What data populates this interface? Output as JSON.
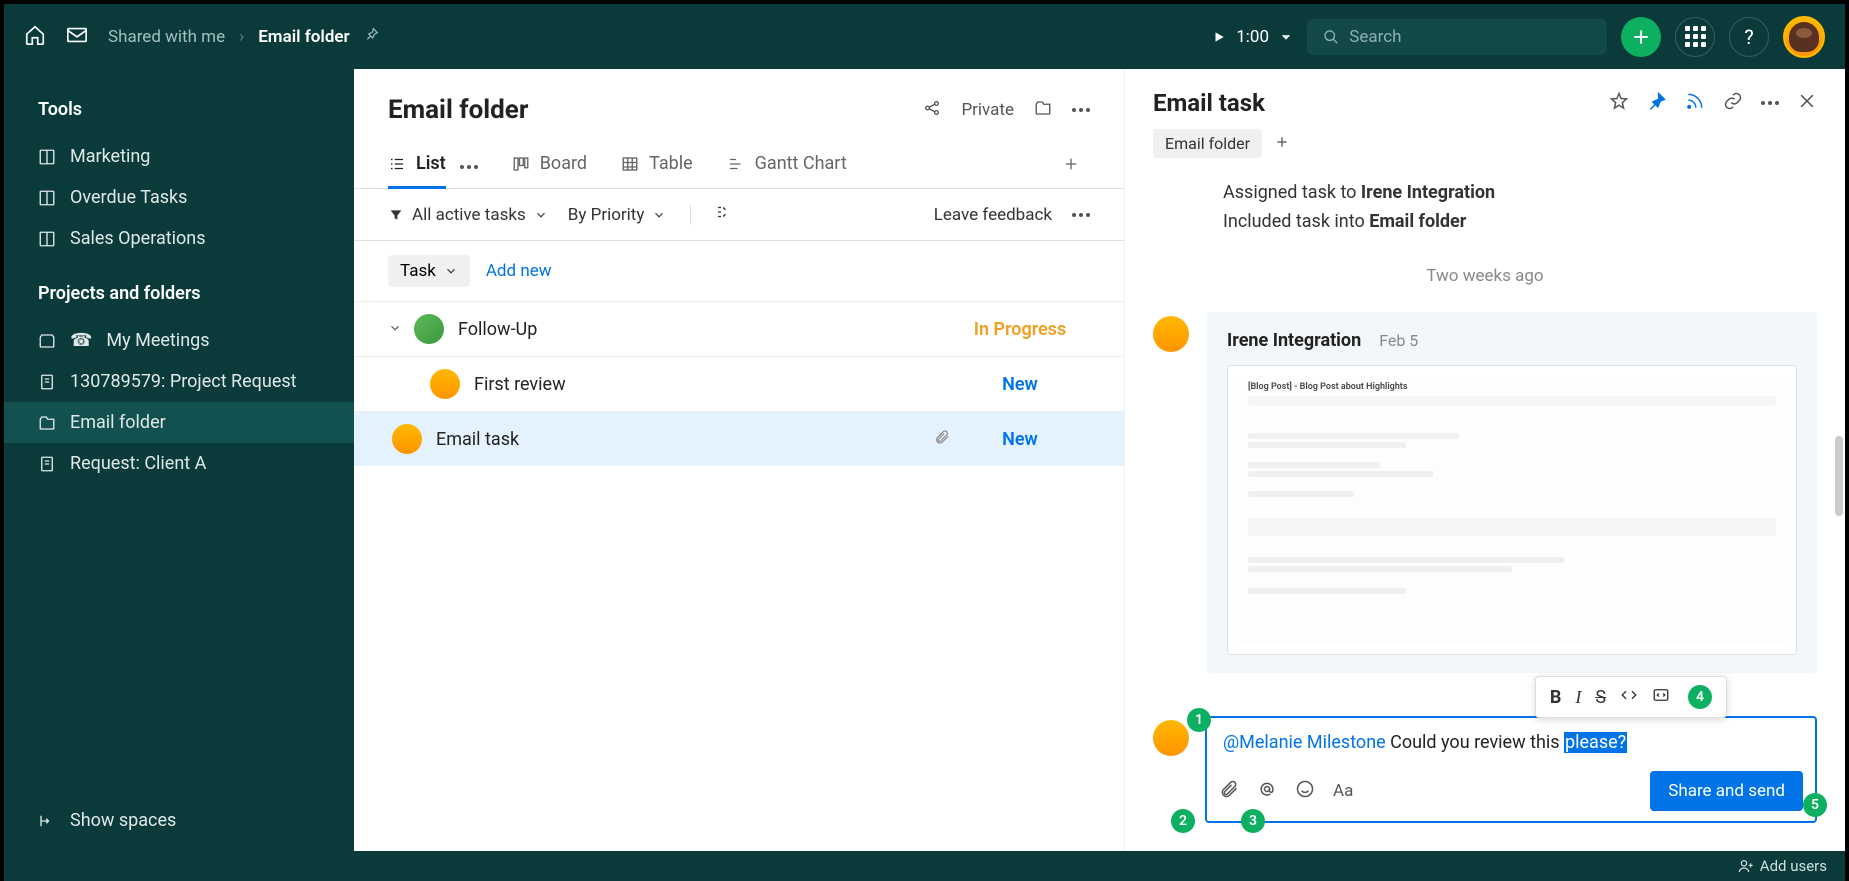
{
  "header": {
    "breadcrumb_parent": "Shared with me",
    "breadcrumb_current": "Email folder",
    "timer": "1:00",
    "search_placeholder": "Search"
  },
  "sidebar": {
    "tools_title": "Tools",
    "tools": [
      {
        "label": "Marketing"
      },
      {
        "label": "Overdue Tasks"
      },
      {
        "label": "Sales Operations"
      }
    ],
    "projects_title": "Projects and folders",
    "projects": [
      {
        "label": "My Meetings",
        "icon": "phone"
      },
      {
        "label": "130789579: Project Request",
        "icon": "doc"
      },
      {
        "label": "Email folder",
        "icon": "folder",
        "selected": true
      },
      {
        "label": "Request: Client A",
        "icon": "doc"
      }
    ],
    "show_spaces": "Show spaces"
  },
  "center": {
    "title": "Email folder",
    "private_label": "Private",
    "tabs": [
      {
        "label": "List",
        "active": true
      },
      {
        "label": "Board"
      },
      {
        "label": "Table"
      },
      {
        "label": "Gantt Chart"
      }
    ],
    "filter_all": "All active tasks",
    "filter_sort": "By Priority",
    "feedback": "Leave feedback",
    "task_chip": "Task",
    "add_new": "Add new",
    "tasks": [
      {
        "title": "Follow-Up",
        "status": "In Progress",
        "status_class": "st-progress",
        "avatar": "av-green",
        "expandable": true
      },
      {
        "title": "First review",
        "status": "New",
        "status_class": "st-new",
        "avatar": "av-orange",
        "indent": 2
      },
      {
        "title": "Email task",
        "status": "New",
        "status_class": "st-new",
        "avatar": "av-orange",
        "indent": 1,
        "attachment": true,
        "selected": true
      }
    ]
  },
  "rpanel": {
    "title": "Email task",
    "chip": "Email folder",
    "activity": [
      {
        "prefix": "Assigned task to ",
        "bold": "Irene Integration"
      },
      {
        "prefix": "Included task into ",
        "bold": "Email folder"
      }
    ],
    "timestamp": "Two weeks ago",
    "comment_author": "Irene Integration",
    "comment_date": "Feb 5",
    "thumb_title": "[Blog Post] - Blog Post about Highlights",
    "reply_mention": "@Melanie Milestone",
    "reply_text": " Could you review this ",
    "reply_selected": "please?",
    "format_aa": "Aa",
    "send_button": "Share and send"
  },
  "bottom": {
    "add_users": "Add users"
  },
  "badges": [
    "1",
    "2",
    "3",
    "4",
    "5"
  ]
}
